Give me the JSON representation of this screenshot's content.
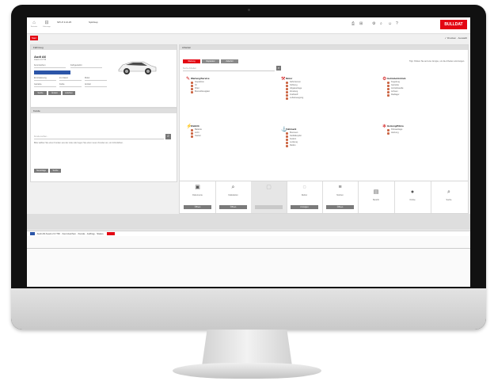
{
  "colors": {
    "accent": "#e30613",
    "button_grey": "#7a7a7a",
    "panel_header": "#dedede"
  },
  "topbar": {
    "icons": [
      {
        "name": "home-icon",
        "glyph": "⌂",
        "label": "Startseite"
      },
      {
        "name": "car-icon",
        "glyph": "⊟",
        "label": "Fahrzeuge"
      }
    ],
    "items": [
      "SPI-P 4-M-25",
      "Spitzkap"
    ],
    "brand": "BULLDAT"
  },
  "subbar": {
    "red_tab": "Start",
    "right_items": [
      "Drucken",
      "Auswahl"
    ]
  },
  "vehicle_panel": {
    "title": "Fahrzeug",
    "name": "Audi A6",
    "sub": "Avant 2.0 TDI",
    "fields": [
      "Kennzeichen",
      "Fahrgestellnr.",
      "Erstzulassung",
      "km-Stand",
      "Motor",
      "Getriebe",
      "Farbe",
      "Antrieb"
    ],
    "buttons": [
      "Suche",
      "Ändern",
      "Löschen"
    ]
  },
  "customer_panel": {
    "title": "Kunde",
    "search_placeholder": "Kunde suchen...",
    "note": "Bitte wählen Sie einen Kunden aus der Liste oder legen Sie einen neuen Kunden an, um fortzufahren.",
    "buttons": [
      "Neuanlage",
      "Suche"
    ]
  },
  "info_panel": {
    "title": "Arbeiten",
    "tabs": [
      "Wartung",
      "Reparatur",
      "Zubehör"
    ],
    "hint": "Tipp: Klicken Sie auf eine Gruppe, um die Arbeiten anzuzeigen.",
    "search_placeholder": "Suche Arbeiten",
    "groups": [
      {
        "title": "Wartung/Service",
        "icon": "wrench-icon",
        "items": [
          "Inspektion",
          "Öl",
          "Filter",
          "Bremsflüssigkeit"
        ]
      },
      {
        "title": "Motor",
        "icon": "engine-icon",
        "items": [
          "Zahnriemen",
          "Kühlung",
          "Abgasanlage",
          "Zündung",
          "Kraftstoff",
          "Luftansaugung"
        ]
      },
      {
        "title": "Getriebe/Antrieb",
        "icon": "gear-icon",
        "items": [
          "Kupplung",
          "Getriebe",
          "Antriebswelle",
          "Achsen",
          "Radlager"
        ]
      },
      {
        "title": "Elektrik",
        "icon": "bolt-icon",
        "items": [
          "Batterie",
          "Licht",
          "Starter"
        ]
      },
      {
        "title": "Fahrwerk",
        "icon": "suspension-icon",
        "items": [
          "Bremsen",
          "Stoßdämpfer",
          "Federn",
          "Lenkung",
          "Reifen"
        ]
      },
      {
        "title": "Heizung/Klima",
        "icon": "thermo-icon",
        "items": [
          "Klimaanlage",
          "Heizung"
        ]
      }
    ]
  },
  "bottom_cells": [
    {
      "name": "documents",
      "glyph": "▣",
      "label": "Dokumente",
      "button": "Öffnen"
    },
    {
      "name": "calculation",
      "glyph": "⌕",
      "label": "Kalkulation",
      "button": "Öffnen"
    },
    {
      "name": "empty",
      "glyph": "▢",
      "label": "",
      "button": ""
    },
    {
      "name": "tires",
      "glyph": "◌",
      "label": "Reifen",
      "button": "Anzeigen"
    },
    {
      "name": "notes",
      "glyph": "≡",
      "label": "Notizen",
      "button": "Öffnen"
    },
    {
      "name": "report",
      "glyph": "▤",
      "label": "Bericht",
      "button": ""
    },
    {
      "name": "globe",
      "glyph": "●",
      "label": "Online",
      "button": ""
    },
    {
      "name": "search",
      "glyph": "⌕",
      "label": "Suche",
      "button": ""
    }
  ],
  "statusbar": {
    "text": "Audi A6 Avant 2.0 TDI · Kennzeichen · Kunde · Auftrag · Status"
  }
}
